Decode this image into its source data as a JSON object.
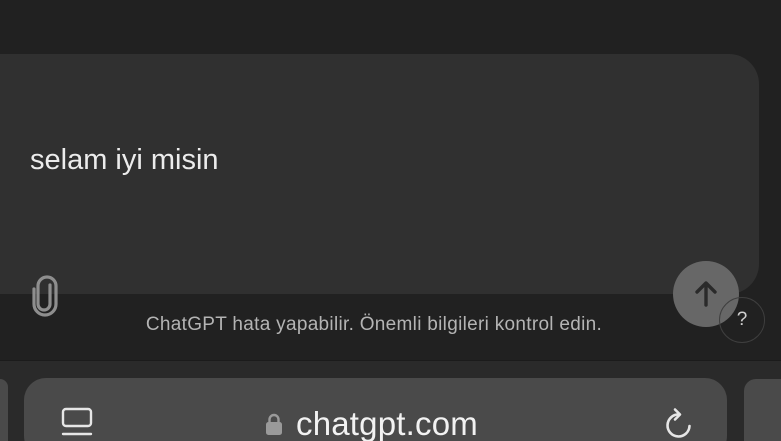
{
  "composer": {
    "input_value": "selam iyi misin",
    "attach_icon": "paperclip-icon",
    "send_icon": "arrow-up-icon"
  },
  "footer": {
    "disclaimer": "ChatGPT hata yapabilir. Önemli bilgileri kontrol edin.",
    "help_label": "?"
  },
  "browser": {
    "url": "chatgpt.com",
    "tab_icon": "tab-overview-icon",
    "lock_icon": "lock-icon",
    "reload_icon": "reload-icon"
  },
  "colors": {
    "background": "#212121",
    "composer": "#303030",
    "send_button": "#676767",
    "address_bar": "#4a4a4a"
  }
}
